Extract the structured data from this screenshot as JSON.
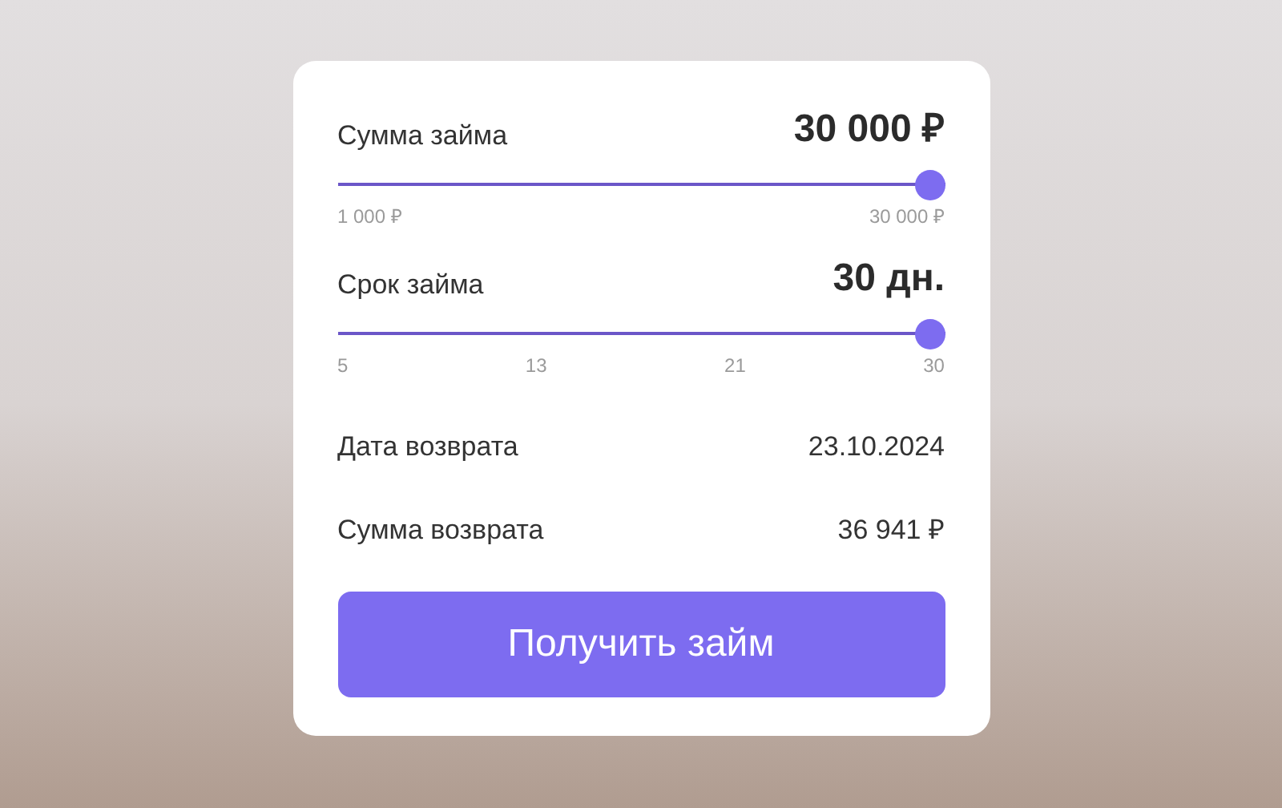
{
  "sliders": [
    {
      "label": "Сумма займа",
      "value": "30 000 ₽",
      "level": 1,
      "ticks": [
        "1 000 ₽",
        "30 000 ₽"
      ]
    },
    {
      "label": "Срок займа",
      "value": "30 дн.",
      "level": 1,
      "ticks": [
        "5",
        "13",
        "21",
        "30"
      ]
    }
  ],
  "summary": [
    {
      "label": "Дата возврата",
      "value": "23.10.2024"
    },
    {
      "label": "Сумма возврата",
      "value": "36 941 ₽"
    }
  ],
  "button": "Получить займ"
}
